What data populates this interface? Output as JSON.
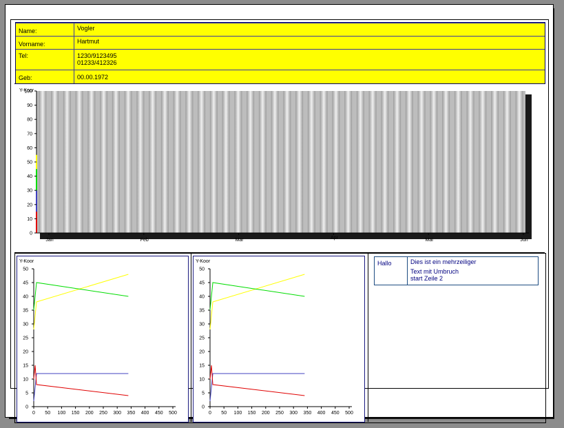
{
  "info": {
    "name_label": "Name:",
    "name_value": "Vogler",
    "vorname_label": "Vorname:",
    "vorname_value": "Hartmut",
    "tel_label": "Tel:",
    "tel_value": "1230/9123495\n01233/412326",
    "geb_label": "Geb:",
    "geb_value": "00.00.1972"
  },
  "text_table": {
    "left": "Hallo",
    "line1": "Dies ist ein mehrzeiliger",
    "line2": "Text mit Umbruch",
    "line3": "start Zeile 2"
  },
  "colors": {
    "info_bg": "#ffff00",
    "chart_bar": "#bdbdbd",
    "series_yellow": "#ffff00",
    "series_green": "#00dd00",
    "series_blue": "#4040c0",
    "series_red": "#e00000",
    "frame_blue": "#1a1a80"
  },
  "chart_data": [
    {
      "type": "bar",
      "ylabel": "Y-Koor",
      "ylim": [
        0,
        100
      ],
      "yticks": [
        0,
        10,
        20,
        30,
        40,
        50,
        60,
        70,
        80,
        90,
        100
      ],
      "xticks": [
        "Jan",
        "Feb",
        "Mar",
        "Apr",
        "Mai",
        "Jun"
      ],
      "bar_count": 40,
      "values": [
        100,
        100,
        100,
        100,
        100,
        100,
        100,
        100,
        100,
        100,
        100,
        100,
        100,
        100,
        100,
        100,
        100,
        100,
        100,
        100,
        100,
        100,
        100,
        100,
        100,
        100,
        100,
        100,
        100,
        100,
        100,
        100,
        100,
        100,
        100,
        100,
        100,
        100,
        100,
        100
      ],
      "axis_segments": [
        {
          "from": 0,
          "to": 15,
          "color": "#e00000"
        },
        {
          "from": 15,
          "to": 30,
          "color": "#4040c0"
        },
        {
          "from": 30,
          "to": 45,
          "color": "#00dd00"
        },
        {
          "from": 45,
          "to": 55,
          "color": "#ffff00"
        }
      ],
      "grid": false
    },
    {
      "type": "line",
      "ylabel": "Y-Koor",
      "xlim": [
        0,
        500
      ],
      "ylim": [
        0,
        50
      ],
      "xticks": [
        0,
        50,
        100,
        150,
        200,
        250,
        300,
        350,
        400,
        450,
        500
      ],
      "yticks": [
        0,
        5,
        10,
        15,
        20,
        25,
        30,
        35,
        40,
        45,
        50
      ],
      "series": [
        {
          "color": "#ffff00",
          "x": [
            0,
            10,
            340
          ],
          "y": [
            28,
            38,
            48
          ]
        },
        {
          "color": "#00dd00",
          "x": [
            0,
            10,
            340
          ],
          "y": [
            35,
            45,
            40
          ]
        },
        {
          "color": "#4040c0",
          "x": [
            0,
            10,
            340
          ],
          "y": [
            2,
            12,
            12
          ]
        },
        {
          "color": "#e00000",
          "x": [
            0,
            5,
            10,
            340
          ],
          "y": [
            10,
            15,
            8,
            4
          ]
        }
      ],
      "grid": false
    },
    {
      "type": "line",
      "ylabel": "Y-Koor",
      "xlim": [
        0,
        500
      ],
      "ylim": [
        0,
        50
      ],
      "xticks": [
        0,
        50,
        100,
        150,
        200,
        250,
        300,
        350,
        400,
        450,
        500
      ],
      "yticks": [
        0,
        5,
        10,
        15,
        20,
        25,
        30,
        35,
        40,
        45,
        50
      ],
      "series": [
        {
          "color": "#ffff00",
          "x": [
            0,
            10,
            340
          ],
          "y": [
            28,
            38,
            48
          ]
        },
        {
          "color": "#00dd00",
          "x": [
            0,
            10,
            340
          ],
          "y": [
            35,
            45,
            40
          ]
        },
        {
          "color": "#4040c0",
          "x": [
            0,
            10,
            340
          ],
          "y": [
            2,
            12,
            12
          ]
        },
        {
          "color": "#e00000",
          "x": [
            0,
            5,
            10,
            340
          ],
          "y": [
            10,
            15,
            8,
            4
          ]
        }
      ],
      "grid": false
    }
  ]
}
